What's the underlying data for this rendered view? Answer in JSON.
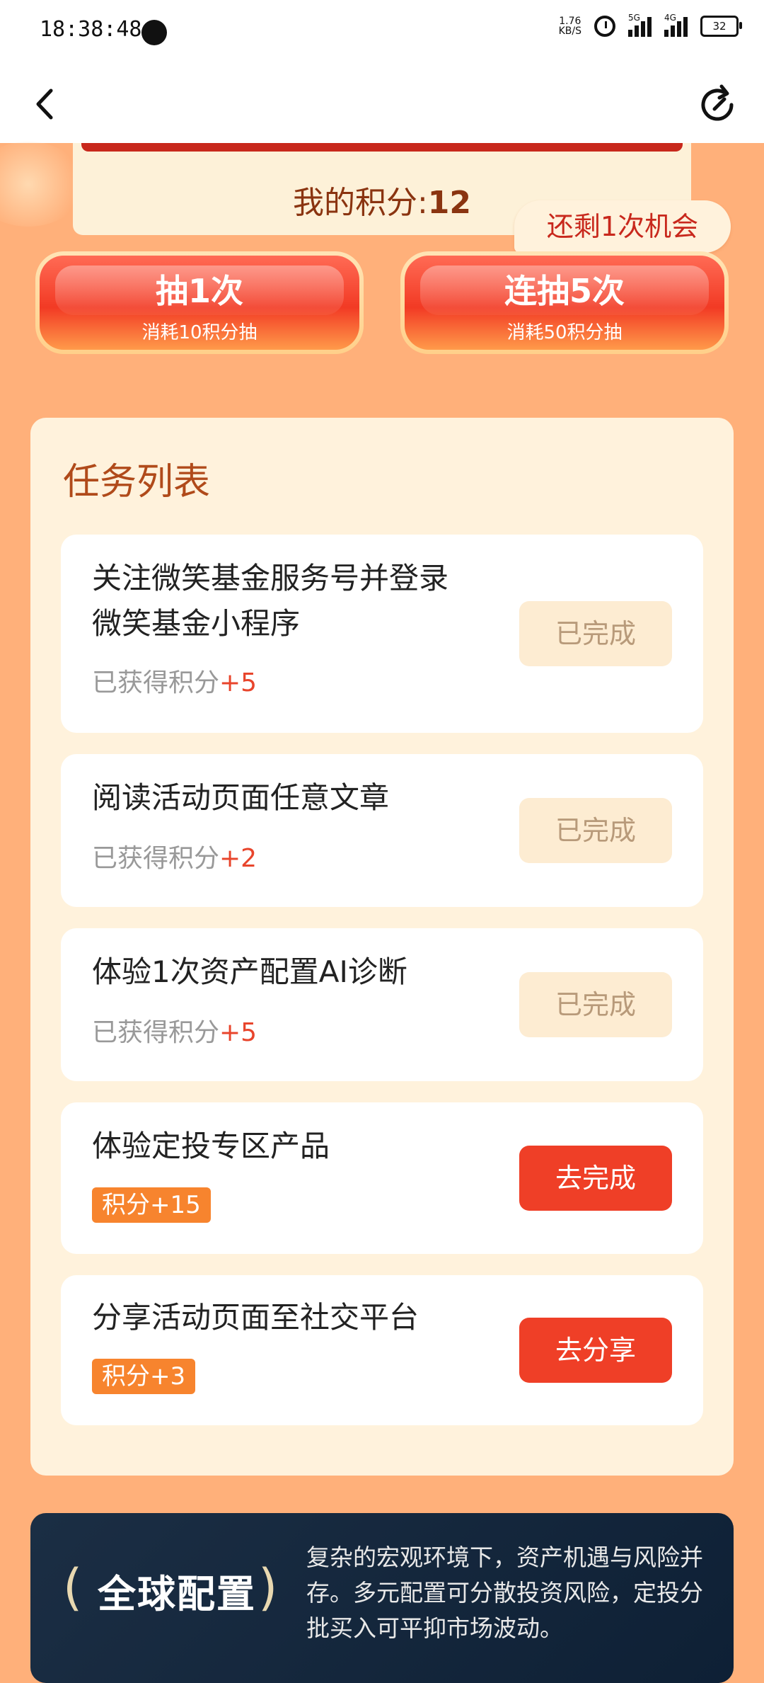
{
  "status_bar": {
    "time": "18:38:48",
    "net_speed_value": "1.76",
    "net_speed_unit": "KB/S",
    "signal1_label": "5G",
    "signal2_label": "4G",
    "battery": "32"
  },
  "header": {
    "back_icon": "chevron-left-icon",
    "refresh_icon": "refresh-icon"
  },
  "points": {
    "label": "我的积分:",
    "value": "12"
  },
  "chance_badge": "还剩1次机会",
  "draw_buttons": [
    {
      "main": "抽1次",
      "sub": "消耗10积分抽"
    },
    {
      "main": "连抽5次",
      "sub": "消耗50积分抽"
    }
  ],
  "tasks": {
    "title": "任务列表",
    "items": [
      {
        "name_line1": "关注微笑基金服务号并登录",
        "name_line2": "微笑基金小程序",
        "earned_label": "已获得积分",
        "earned_value": "+5",
        "button": "已完成"
      },
      {
        "name_line1": "阅读活动页面任意文章",
        "earned_label": "已获得积分",
        "earned_value": "+2",
        "button": "已完成"
      },
      {
        "name_line1": "体验1次资产配置AI诊断",
        "earned_label": "已获得积分",
        "earned_value": "+5",
        "button": "已完成"
      },
      {
        "name_line1": "体验定投专区产品",
        "badge": "积分+15",
        "button": "去完成"
      },
      {
        "name_line1": "分享活动页面至社交平台",
        "badge": "积分+3",
        "button": "去分享"
      }
    ]
  },
  "banner": {
    "title": "全球配置",
    "description": "复杂的宏观环境下，资产机遇与风险并存。多元配置可分散投资风险，定投分批买入可平抑市场波动。"
  },
  "colors": {
    "page_bg": "#ffb07a",
    "accent_red": "#ef3f27",
    "task_panel_bg": "#fff2dc",
    "badge_orange": "#f7842e"
  }
}
